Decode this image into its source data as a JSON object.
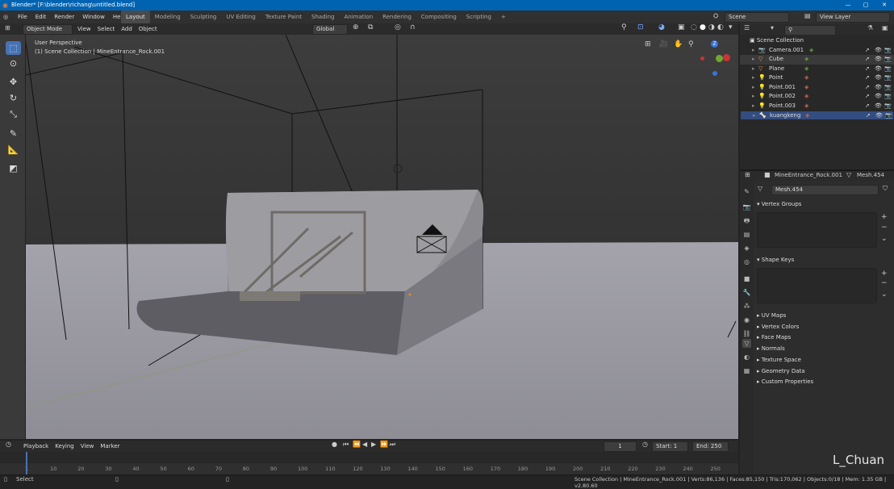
{
  "window": {
    "title": "Blender* [F:\\blender\\richang\\untitled.blend]",
    "min_icon": "minimize-icon",
    "max_icon": "maximize-icon",
    "close_icon": "close-icon"
  },
  "menu": {
    "items": [
      "File",
      "Edit",
      "Render",
      "Window",
      "Help"
    ],
    "workspaces": [
      "Layout",
      "Modeling",
      "Sculpting",
      "UV Editing",
      "Texture Paint",
      "Shading",
      "Animation",
      "Rendering",
      "Compositing",
      "Scripting"
    ],
    "add_tab": "+",
    "scene": "Scene",
    "view_layer": "View Layer"
  },
  "viewport": {
    "mode": "Object Mode",
    "menus": [
      "View",
      "Select",
      "Add",
      "Object"
    ],
    "orientation": "Global",
    "perspective": "User Perspective",
    "collection_info": "(1) Scene Collection | MineEntrance_Rock.001"
  },
  "outliner": {
    "root": "Scene Collection",
    "items": [
      {
        "name": "Camera.001",
        "icon": "camera-icon",
        "badge": "#6a9f4b"
      },
      {
        "name": "Cube",
        "icon": "mesh-icon",
        "badge": "#6a9f4b"
      },
      {
        "name": "Plane",
        "icon": "mesh-icon",
        "badge": "#6a9f4b"
      },
      {
        "name": "Point",
        "icon": "light-icon",
        "badge": "#d26a4b"
      },
      {
        "name": "Point.001",
        "icon": "light-icon",
        "badge": "#d26a4b"
      },
      {
        "name": "Point.002",
        "icon": "light-icon",
        "badge": "#d26a4b"
      },
      {
        "name": "Point.003",
        "icon": "light-icon",
        "badge": "#d26a4b"
      },
      {
        "name": "kuangkeng",
        "icon": "armature-icon",
        "badge": "#d26a4b"
      }
    ]
  },
  "properties": {
    "object": "MineEntrance_Rock.001",
    "mesh": "Mesh.454",
    "data_name": "Mesh.454",
    "panels": {
      "vertex_groups": "Vertex Groups",
      "shape_keys": "Shape Keys",
      "collapsed": [
        "UV Maps",
        "Vertex Colors",
        "Face Maps",
        "Normals",
        "Texture Space",
        "Geometry Data",
        "Custom Properties"
      ]
    }
  },
  "timeline": {
    "menus": [
      "Playback",
      "Keying",
      "View",
      "Marker"
    ],
    "current_frame": "1",
    "start_label": "Start:",
    "start": "1",
    "end_label": "End:",
    "end": "250",
    "ticks": [
      "1",
      "10",
      "20",
      "30",
      "40",
      "50",
      "60",
      "70",
      "80",
      "90",
      "100",
      "110",
      "120",
      "130",
      "140",
      "150",
      "160",
      "170",
      "180",
      "190",
      "200",
      "210",
      "220",
      "230",
      "240",
      "250"
    ]
  },
  "status": {
    "left": "Select",
    "right": "Scene Collection | MineEntrance_Rock.001 | Verts:86,136 | Faces:85,150 | Tris:170,062 | Objects:0/18 | Mem: 1.35 GB | v2.80.60"
  },
  "watermark": "L_Chuan",
  "colors": {
    "accent": "#4772b3",
    "selected_row": "#334d80",
    "titlebar": "#0063b1"
  }
}
